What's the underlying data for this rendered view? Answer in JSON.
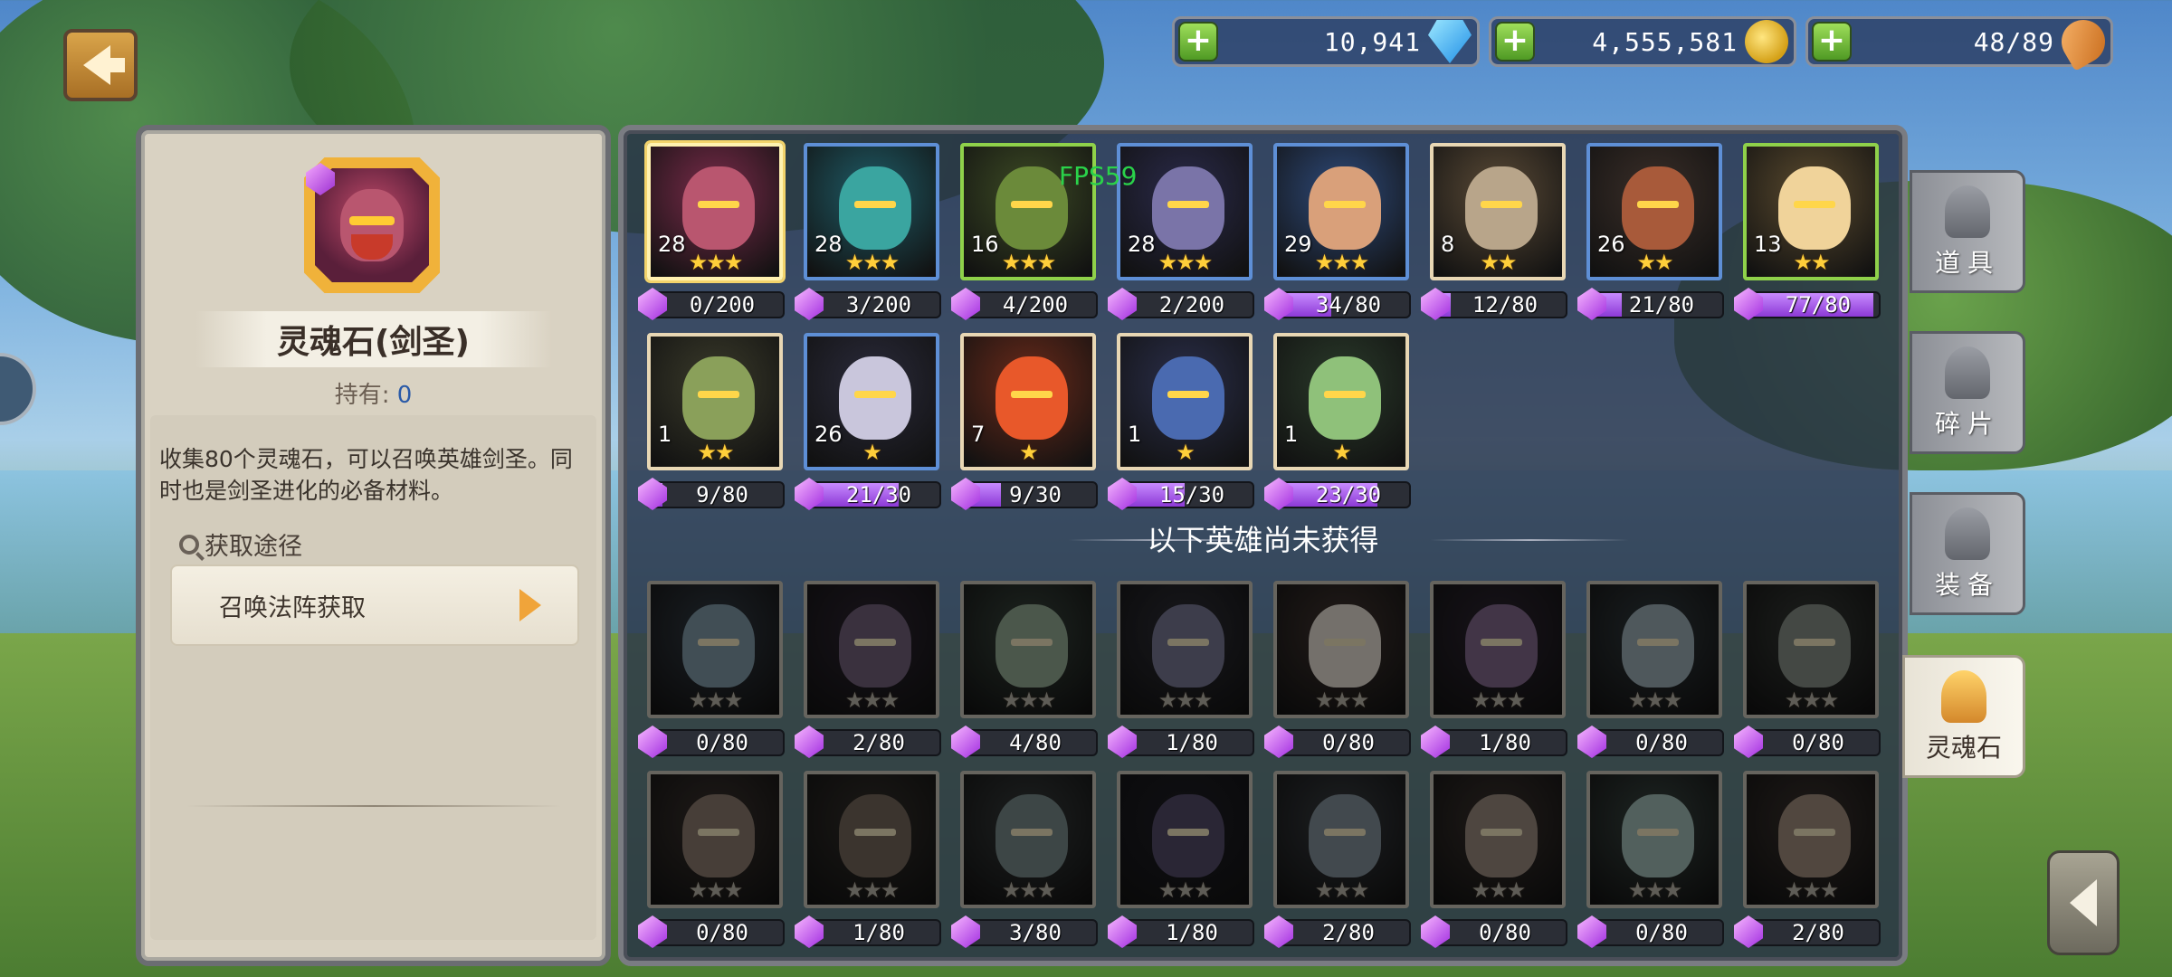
{
  "resources": [
    {
      "value": "10,941",
      "icon": "diamond-icon"
    },
    {
      "value": "4,555,581",
      "icon": "gold-coins-icon"
    },
    {
      "value": "48/89",
      "icon": "drumstick-icon"
    }
  ],
  "fps": "FPS59",
  "detail": {
    "title": "灵魂石(剑圣)",
    "own_label": "持有:",
    "own_value": "0",
    "description": "收集80个灵魂石，可以召唤英雄剑圣。同时也是剑圣进化的必备材料。",
    "source_label": "获取途径",
    "source_button": "召唤法阵获取"
  },
  "owned_heroes": [
    {
      "level": "28",
      "stars": "★★★",
      "count": "0/200",
      "progress": 0.0,
      "quality": "selected",
      "color": "#7a2b4a",
      "skin": "#b9566f"
    },
    {
      "level": "28",
      "stars": "★★★",
      "count": "3/200",
      "progress": 0.015,
      "quality": "blue",
      "color": "#1f5b66",
      "skin": "#3aa5a0"
    },
    {
      "level": "16",
      "stars": "★★★",
      "count": "4/200",
      "progress": 0.02,
      "quality": "green",
      "color": "#3c4a24",
      "skin": "#6b8a3a"
    },
    {
      "level": "28",
      "stars": "★★★",
      "count": "2/200",
      "progress": 0.01,
      "quality": "blue",
      "color": "#2a2a4a",
      "skin": "#7a74a8"
    },
    {
      "level": "29",
      "stars": "★★★",
      "count": "34/80",
      "progress": 0.425,
      "quality": "blue",
      "color": "#2e4a7a",
      "skin": "#d9a07a"
    },
    {
      "level": "8",
      "stars": "★★",
      "count": "12/80",
      "progress": 0.15,
      "quality": "gold",
      "color": "#5a4a36",
      "skin": "#b8a58a"
    },
    {
      "level": "26",
      "stars": "★★",
      "count": "21/80",
      "progress": 0.2625,
      "quality": "blue",
      "color": "#3a2e28",
      "skin": "#a85a3a"
    },
    {
      "level": "13",
      "stars": "★★",
      "count": "77/80",
      "progress": 0.9625,
      "quality": "green",
      "color": "#5a4a2e",
      "skin": "#f0d39a"
    },
    {
      "level": "1",
      "stars": "★★",
      "count": "9/80",
      "progress": 0.1125,
      "quality": "gold",
      "color": "#3a3a2a",
      "skin": "#8aa05a"
    },
    {
      "level": "26",
      "stars": "★",
      "count": "21/30",
      "progress": 0.7,
      "quality": "blue",
      "color": "#2a2a3a",
      "skin": "#c9c6dc"
    },
    {
      "level": "7",
      "stars": "★",
      "count": "9/30",
      "progress": 0.3,
      "quality": "gold",
      "color": "#6a2a1a",
      "skin": "#e8582a"
    },
    {
      "level": "1",
      "stars": "★",
      "count": "15/30",
      "progress": 0.5,
      "quality": "gold",
      "color": "#2a2e4a",
      "skin": "#4a6ab0"
    },
    {
      "level": "1",
      "stars": "★",
      "count": "23/30",
      "progress": 0.7667,
      "quality": "gold",
      "color": "#2a3a2a",
      "skin": "#8fc17a"
    }
  ],
  "not_acquired_label": "以下英雄尚未获得",
  "locked_heroes": [
    {
      "stars": "★★★",
      "count": "0/80",
      "progress": 0.0,
      "color": "#1a3a5a",
      "skin": "#3a9ad0"
    },
    {
      "stars": "★★★",
      "count": "2/80",
      "progress": 0.025,
      "color": "#3a1a4a",
      "skin": "#8a4aa8"
    },
    {
      "stars": "★★★",
      "count": "4/80",
      "progress": 0.05,
      "color": "#1a4a2a",
      "skin": "#5ab05a"
    },
    {
      "stars": "★★★",
      "count": "1/80",
      "progress": 0.0125,
      "color": "#2a2a4a",
      "skin": "#6a6ad0"
    },
    {
      "stars": "★★★",
      "count": "0/80",
      "progress": 0.0,
      "color": "#5a2a1a",
      "skin": "#e8c8a8"
    },
    {
      "stars": "★★★",
      "count": "1/80",
      "progress": 0.0125,
      "color": "#3a1a4a",
      "skin": "#a84ad0"
    },
    {
      "stars": "★★★",
      "count": "0/80",
      "progress": 0.0,
      "color": "#1a3a4a",
      "skin": "#6aa8c8"
    },
    {
      "stars": "★★★",
      "count": "0/80",
      "progress": 0.0,
      "color": "#2a3a2a",
      "skin": "#6a8a6a"
    },
    {
      "stars": "★★★",
      "count": "0/80",
      "progress": 0.0,
      "color": "#4a2a1a",
      "skin": "#a86a3a"
    },
    {
      "stars": "★★★",
      "count": "1/80",
      "progress": 0.0125,
      "color": "#3a2a1a",
      "skin": "#8a5a2a"
    },
    {
      "stars": "★★★",
      "count": "3/80",
      "progress": 0.0375,
      "color": "#2a3a3a",
      "skin": "#4a8a8a"
    },
    {
      "stars": "★★★",
      "count": "1/80",
      "progress": 0.0125,
      "color": "#1a1a3a",
      "skin": "#5a3aa8"
    },
    {
      "stars": "★★★",
      "count": "2/80",
      "progress": 0.025,
      "color": "#2a3a4a",
      "skin": "#5a8ab0"
    },
    {
      "stars": "★★★",
      "count": "0/80",
      "progress": 0.0,
      "color": "#4a2a1a",
      "skin": "#b07a4a"
    },
    {
      "stars": "★★★",
      "count": "0/80",
      "progress": 0.0,
      "color": "#1a4a3a",
      "skin": "#5ac0a8"
    },
    {
      "stars": "★★★",
      "count": "2/80",
      "progress": 0.025,
      "color": "#4a2a1a",
      "skin": "#c07a3a"
    }
  ],
  "side_tabs": [
    {
      "label": "道具",
      "active": false
    },
    {
      "label": "碎片",
      "active": false
    },
    {
      "label": "装备",
      "active": false
    },
    {
      "label": "灵魂石",
      "active": true
    }
  ]
}
